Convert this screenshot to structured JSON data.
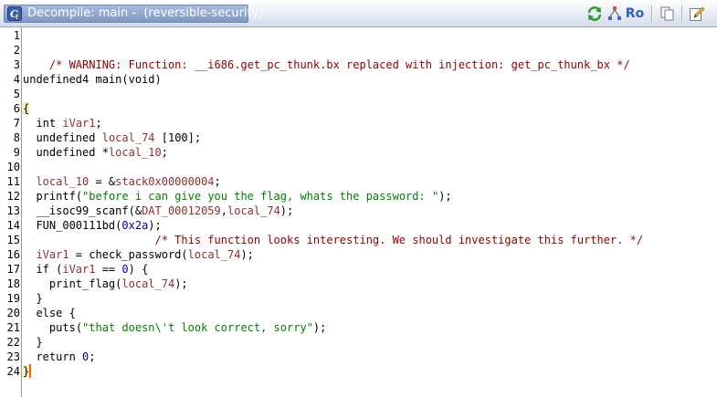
{
  "window": {
    "title": "Decompile: main -  (reversible-security)",
    "icon": "ghidra-decompiler-icon"
  },
  "toolbar": {
    "refresh_icon": "refresh-arrows-icon",
    "graph_icon": "function-graph-icon",
    "ro_label": "Ro",
    "copy_icon": "copy-snapshot-icon",
    "edit_icon": "edit-pencil-icon",
    "accent": "#2d5ec2"
  },
  "line_numbers": [
    "1",
    "2",
    "3",
    "4",
    "5",
    "6",
    "7",
    "8",
    "9",
    "10",
    "11",
    "12",
    "13",
    "14",
    "15",
    "16",
    "17",
    "18",
    "19",
    "20",
    "21",
    "22",
    "23",
    "24"
  ],
  "code": {
    "l2": "/* WARNING: Function: __i686.get_pc_thunk.bx replaced with injection: get_pc_thunk_bx */",
    "l4_type": "undefined4",
    "l4_name": "main",
    "l4_params": "(void)",
    "l6": "{",
    "l7_type": "int",
    "l7_var": "iVar1",
    "l7_end": ";",
    "l8_type": "undefined",
    "l8_var": "local_74",
    "l8_arr": "[100]",
    "l8_end": ";",
    "l9_type": "undefined",
    "l9_star": "*",
    "l9_var": "local_10",
    "l9_end": ";",
    "l11_var": "local_10",
    "l11_eq": " = &",
    "l11_val": "stack0x00000004",
    "l11_end": ";",
    "l12_fn": "printf",
    "l12_open": "(",
    "l12_str": "\"before i can give you the flag, whats the password: \"",
    "l12_end": ");",
    "l13_fn": "__isoc99_scanf",
    "l13_open": "(&",
    "l13_glob": "DAT_00012059",
    "l13_comma": ",",
    "l13_var": "local_74",
    "l13_end": ");",
    "l14_fn": "FUN_000111bd",
    "l14_open": "(",
    "l14_num": "0x2a",
    "l14_end": ");",
    "l15": "/* This function looks interesting. We should investigate this further. */",
    "l16_var": "iVar1",
    "l16_eq": " = ",
    "l16_fn": "check_password",
    "l16_open": "(",
    "l16_arg": "local_74",
    "l16_end": ");",
    "l17_kw": "if",
    "l17_open": " (",
    "l17_var": "iVar1",
    "l17_op": " == ",
    "l17_num": "0",
    "l17_end": ") {",
    "l18_fn": "print_flag",
    "l18_open": "(",
    "l18_arg": "local_74",
    "l18_end": ");",
    "l19": "}",
    "l20": "else {",
    "l21_fn": "puts",
    "l21_open": "(",
    "l21_str": "\"that doesn\\'t look correct, sorry\"",
    "l21_end": ");",
    "l22": "}",
    "l23_kw": "return",
    "l23_num": "0",
    "l23_end": ";",
    "l24": "}"
  }
}
